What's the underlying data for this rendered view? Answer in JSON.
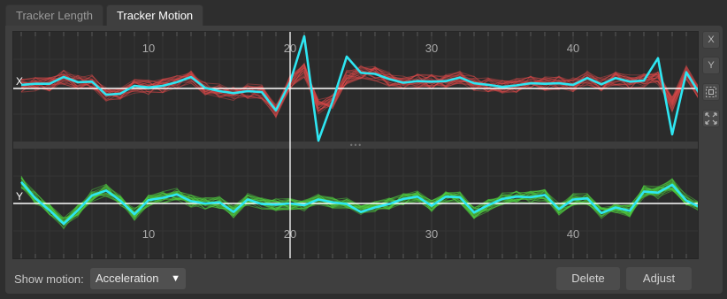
{
  "tabs": [
    {
      "label": "Tracker Length",
      "active": false
    },
    {
      "label": "Tracker Motion",
      "active": true
    }
  ],
  "graph": {
    "x_channel_label": "X",
    "y_channel_label": "Y",
    "frame_ticks": [
      "10",
      "20",
      "30",
      "40"
    ],
    "current_frame": 20,
    "splitter_glyph": "•••",
    "colors": {
      "x_tracks": "#d94a4a",
      "y_tracks": "#4fd040",
      "average_curve": "#2ee6f2",
      "zero_line": "#ffffff",
      "cursor": "#ffffff",
      "background": "#2b2b2b"
    },
    "average_x": [
      0.07,
      0.09,
      0.09,
      0.22,
      0.12,
      0.13,
      -0.12,
      -0.1,
      0.05,
      0.02,
      0.05,
      0.12,
      0.22,
      0.01,
      -0.05,
      -0.09,
      -0.05,
      -0.07,
      -0.42,
      0.12,
      1.0,
      -1.0,
      -0.25,
      0.61,
      0.3,
      0.28,
      0.18,
      0.11,
      0.14,
      0.13,
      0.14,
      0.21,
      0.1,
      0.07,
      0.03,
      0.06,
      0.1,
      0.09,
      0.1,
      0.07,
      0.2,
      0.08,
      0.2,
      0.13,
      0.15,
      0.58,
      -0.88,
      0.31,
      -0.13,
      0.18
    ],
    "average_y": [
      0.38,
      0.09,
      -0.12,
      -0.36,
      -0.12,
      0.14,
      0.23,
      0.05,
      -0.19,
      0.06,
      0.1,
      0.16,
      0.04,
      0.0,
      0.02,
      -0.15,
      0.07,
      -0.01,
      -0.02,
      0.0,
      -0.03,
      0.07,
      0.02,
      -0.01,
      -0.15,
      -0.07,
      -0.01,
      0.08,
      0.12,
      -0.04,
      0.12,
      0.11,
      -0.16,
      -0.03,
      0.08,
      0.12,
      0.11,
      0.15,
      -0.1,
      0.07,
      0.09,
      -0.17,
      -0.07,
      -0.13,
      0.21,
      0.19,
      0.33,
      0.05,
      -0.07,
      -0.06
    ]
  },
  "side_buttons": [
    {
      "label": "X"
    },
    {
      "label": "Y"
    },
    {
      "label": "",
      "icon": "fit-selection-icon"
    },
    {
      "label": "",
      "icon": "expand-icon"
    }
  ],
  "footer": {
    "show_motion_label": "Show motion:",
    "motion_mode": "Acceleration",
    "delete_label": "Delete",
    "adjust_label": "Adjust"
  }
}
